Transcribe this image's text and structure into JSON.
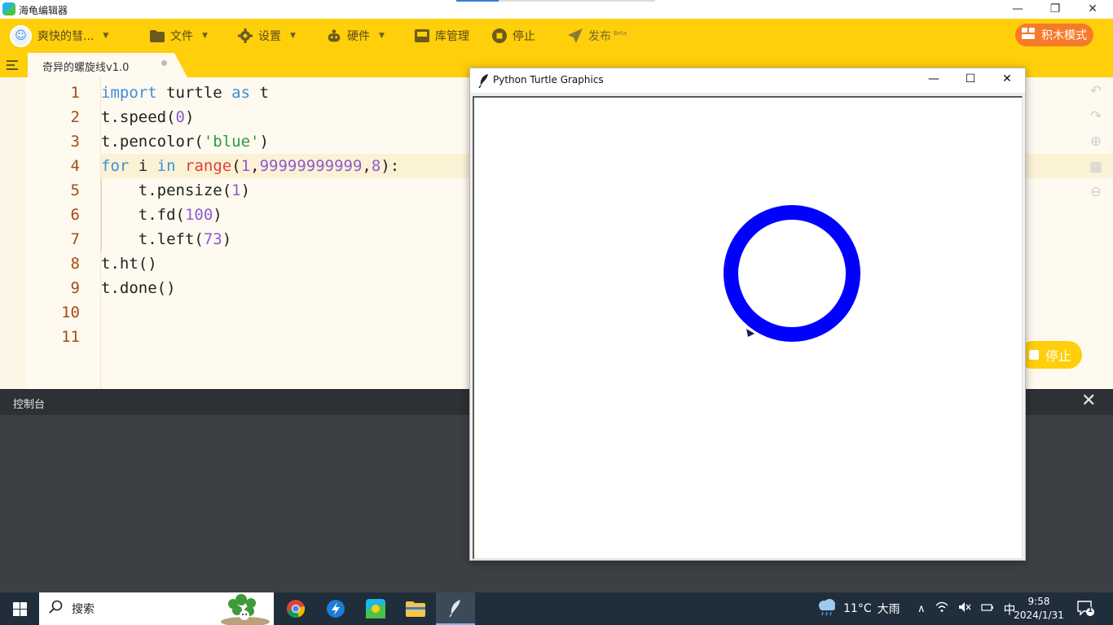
{
  "window": {
    "title": "海龟编辑器",
    "minimize": "—",
    "restore": "❐",
    "close": "✕"
  },
  "toolbar": {
    "account_label": "爽快的彗...",
    "file_label": "文件",
    "settings_label": "设置",
    "hardware_label": "硬件",
    "library_label": "库管理",
    "stop_label": "停止",
    "publish_label": "发布",
    "publish_badge": "Beta",
    "block_mode_label": "积木模式"
  },
  "tabs": [
    {
      "label": "奇异的螺旋线v1.0",
      "unsaved": true
    }
  ],
  "editor": {
    "line_numbers": [
      "1",
      "2",
      "3",
      "4",
      "5",
      "6",
      "7",
      "8",
      "9",
      "10",
      "11"
    ],
    "active_line": 4,
    "lines": [
      [
        {
          "t": "import",
          "c": "kw"
        },
        {
          "t": " turtle ",
          "c": ""
        },
        {
          "t": "as",
          "c": "kw"
        },
        {
          "t": " t",
          "c": ""
        }
      ],
      [
        {
          "t": "t.speed(",
          "c": ""
        },
        {
          "t": "0",
          "c": "num"
        },
        {
          "t": ")",
          "c": ""
        }
      ],
      [
        {
          "t": "t.pencolor(",
          "c": ""
        },
        {
          "t": "'blue'",
          "c": "str"
        },
        {
          "t": ")",
          "c": ""
        }
      ],
      [
        {
          "t": "for",
          "c": "kw"
        },
        {
          "t": " i ",
          "c": ""
        },
        {
          "t": "in",
          "c": "kw"
        },
        {
          "t": " ",
          "c": ""
        },
        {
          "t": "range",
          "c": "bi"
        },
        {
          "t": "(",
          "c": ""
        },
        {
          "t": "1",
          "c": "num"
        },
        {
          "t": ",",
          "c": ""
        },
        {
          "t": "99999999999",
          "c": "num"
        },
        {
          "t": ",",
          "c": ""
        },
        {
          "t": "8",
          "c": "num"
        },
        {
          "t": "):",
          "c": ""
        }
      ],
      [
        {
          "t": "    t.pensize(",
          "c": ""
        },
        {
          "t": "1",
          "c": "num"
        },
        {
          "t": ")",
          "c": ""
        }
      ],
      [
        {
          "t": "    t.fd(",
          "c": ""
        },
        {
          "t": "100",
          "c": "num"
        },
        {
          "t": ")",
          "c": ""
        }
      ],
      [
        {
          "t": "    t.left(",
          "c": ""
        },
        {
          "t": "73",
          "c": "num"
        },
        {
          "t": ")",
          "c": ""
        }
      ],
      [
        {
          "t": "t.ht()",
          "c": ""
        }
      ],
      [
        {
          "t": "t.done()",
          "c": ""
        }
      ],
      [],
      []
    ]
  },
  "run_button": {
    "label": "停止"
  },
  "console": {
    "title": "控制台",
    "close": "✕"
  },
  "turtle_window": {
    "title": "Python Turtle Graphics",
    "minimize": "—",
    "maximize": "☐",
    "close": "✕",
    "ring_color": "#0000ff"
  },
  "taskbar": {
    "search_placeholder": "搜索",
    "weather_temp": "11°C",
    "weather_text": "大雨",
    "ime": "中",
    "time": "9:58",
    "date": "2024/1/31",
    "notification_count": "1"
  },
  "colors": {
    "toolbar": "#fecf0a",
    "block_mode": "#f77a2a",
    "editor_bg": "#fffaf0",
    "console_bg": "#3c4045",
    "taskbar": "#1f2e3a"
  }
}
